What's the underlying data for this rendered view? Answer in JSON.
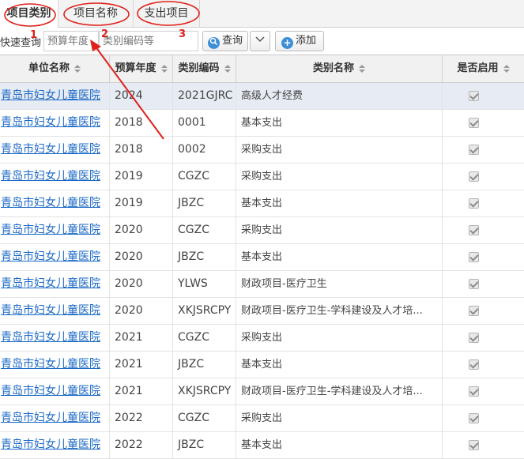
{
  "tabs": [
    {
      "label": "项目类别",
      "active": true
    },
    {
      "label": "项目名称",
      "active": false
    },
    {
      "label": "支出项目",
      "active": false
    }
  ],
  "toolbar": {
    "quick_search_label": "快速查询",
    "year_placeholder": "预算年度",
    "code_placeholder": "类别编码等",
    "query_label": "查询",
    "add_label": "添加"
  },
  "grid": {
    "columns": [
      "单位名称",
      "预算年度",
      "类别编码",
      "类别名称",
      "是否启用"
    ],
    "rows": [
      {
        "unit": "青岛市妇女儿童医院",
        "year": "2024",
        "code": "2021GJRC",
        "name": "高级人才经费",
        "enabled": true
      },
      {
        "unit": "青岛市妇女儿童医院",
        "year": "2018",
        "code": "0001",
        "name": "基本支出",
        "enabled": true
      },
      {
        "unit": "青岛市妇女儿童医院",
        "year": "2018",
        "code": "0002",
        "name": "采购支出",
        "enabled": true
      },
      {
        "unit": "青岛市妇女儿童医院",
        "year": "2019",
        "code": "CGZC",
        "name": "采购支出",
        "enabled": true
      },
      {
        "unit": "青岛市妇女儿童医院",
        "year": "2019",
        "code": "JBZC",
        "name": "基本支出",
        "enabled": true
      },
      {
        "unit": "青岛市妇女儿童医院",
        "year": "2020",
        "code": "CGZC",
        "name": "采购支出",
        "enabled": true
      },
      {
        "unit": "青岛市妇女儿童医院",
        "year": "2020",
        "code": "JBZC",
        "name": "基本支出",
        "enabled": true
      },
      {
        "unit": "青岛市妇女儿童医院",
        "year": "2020",
        "code": "YLWS",
        "name": "财政项目-医疗卫生",
        "enabled": true
      },
      {
        "unit": "青岛市妇女儿童医院",
        "year": "2020",
        "code": "XKJSRCPY",
        "name": "财政项目-医疗卫生-学科建设及人才培...",
        "enabled": true
      },
      {
        "unit": "青岛市妇女儿童医院",
        "year": "2021",
        "code": "CGZC",
        "name": "采购支出",
        "enabled": true
      },
      {
        "unit": "青岛市妇女儿童医院",
        "year": "2021",
        "code": "JBZC",
        "name": "基本支出",
        "enabled": true
      },
      {
        "unit": "青岛市妇女儿童医院",
        "year": "2021",
        "code": "XKJSRCPY",
        "name": "财政项目-医疗卫生-学科建设及人才培...",
        "enabled": true
      },
      {
        "unit": "青岛市妇女儿童医院",
        "year": "2022",
        "code": "CGZC",
        "name": "采购支出",
        "enabled": true
      },
      {
        "unit": "青岛市妇女儿童医院",
        "year": "2022",
        "code": "JBZC",
        "name": "基本支出",
        "enabled": true
      }
    ]
  },
  "annotations": {
    "markers": [
      "1",
      "2",
      "3"
    ],
    "color": "#e0201b"
  },
  "colors": {
    "link": "#1a68c7",
    "selected_row": "#e7ebf3",
    "icon_blue": "#3b8ed8"
  }
}
